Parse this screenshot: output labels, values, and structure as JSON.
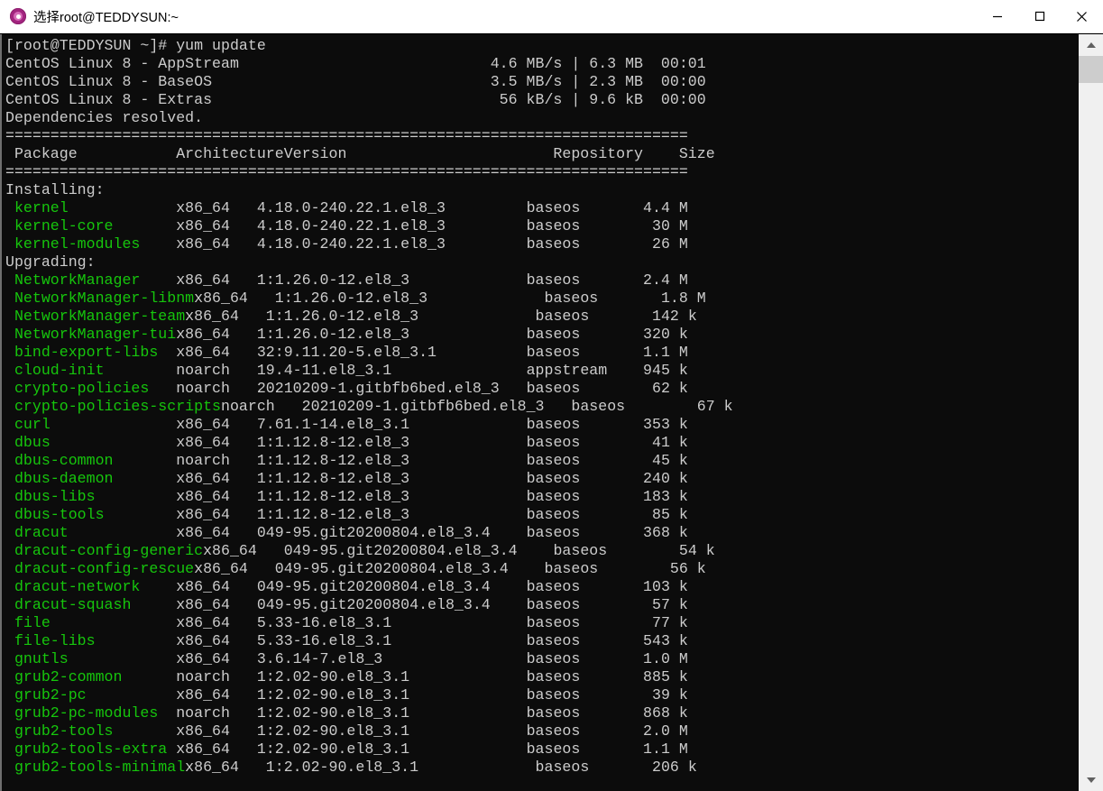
{
  "window": {
    "title": "选择root@TEDDYSUN:~",
    "icon": "terminal-app-icon",
    "controls": {
      "minimize": "minimize-button",
      "maximize": "maximize-button",
      "close": "close-button"
    }
  },
  "terminal": {
    "prompt_line": "[root@TEDDYSUN ~]# yum update",
    "repo_lines": [
      {
        "name": "CentOS Linux 8 - AppStream",
        "speed": "4.6 MB/s",
        "size": "6.3 MB",
        "time": "00:01"
      },
      {
        "name": "CentOS Linux 8 - BaseOS",
        "speed": "3.5 MB/s",
        "size": "2.3 MB",
        "time": "00:00"
      },
      {
        "name": "CentOS Linux 8 - Extras",
        "speed": "56 kB/s",
        "size": "9.6 kB",
        "time": "00:00"
      }
    ],
    "status_line": "Dependencies resolved.",
    "separator": "================================================================================================================================",
    "headers": {
      "package": "Package",
      "architecture": "Architecture",
      "version": "Version",
      "repository": "Repository",
      "size": "Size"
    },
    "sections": [
      {
        "label": "Installing:",
        "rows": [
          {
            "package": "kernel",
            "arch": "x86_64",
            "version": "4.18.0-240.22.1.el8_3",
            "repo": "baseos",
            "size": "4.4 M"
          },
          {
            "package": "kernel-core",
            "arch": "x86_64",
            "version": "4.18.0-240.22.1.el8_3",
            "repo": "baseos",
            "size": "30 M"
          },
          {
            "package": "kernel-modules",
            "arch": "x86_64",
            "version": "4.18.0-240.22.1.el8_3",
            "repo": "baseos",
            "size": "26 M"
          }
        ]
      },
      {
        "label": "Upgrading:",
        "rows": [
          {
            "package": "NetworkManager",
            "arch": "x86_64",
            "version": "1:1.26.0-12.el8_3",
            "repo": "baseos",
            "size": "2.4 M"
          },
          {
            "package": "NetworkManager-libnm",
            "arch": "x86_64",
            "version": "1:1.26.0-12.el8_3",
            "repo": "baseos",
            "size": "1.8 M"
          },
          {
            "package": "NetworkManager-team",
            "arch": "x86_64",
            "version": "1:1.26.0-12.el8_3",
            "repo": "baseos",
            "size": "142 k"
          },
          {
            "package": "NetworkManager-tui",
            "arch": "x86_64",
            "version": "1:1.26.0-12.el8_3",
            "repo": "baseos",
            "size": "320 k"
          },
          {
            "package": "bind-export-libs",
            "arch": "x86_64",
            "version": "32:9.11.20-5.el8_3.1",
            "repo": "baseos",
            "size": "1.1 M"
          },
          {
            "package": "cloud-init",
            "arch": "noarch",
            "version": "19.4-11.el8_3.1",
            "repo": "appstream",
            "size": "945 k"
          },
          {
            "package": "crypto-policies",
            "arch": "noarch",
            "version": "20210209-1.gitbfb6bed.el8_3",
            "repo": "baseos",
            "size": "62 k"
          },
          {
            "package": "crypto-policies-scripts",
            "arch": "noarch",
            "version": "20210209-1.gitbfb6bed.el8_3",
            "repo": "baseos",
            "size": "67 k"
          },
          {
            "package": "curl",
            "arch": "x86_64",
            "version": "7.61.1-14.el8_3.1",
            "repo": "baseos",
            "size": "353 k"
          },
          {
            "package": "dbus",
            "arch": "x86_64",
            "version": "1:1.12.8-12.el8_3",
            "repo": "baseos",
            "size": "41 k"
          },
          {
            "package": "dbus-common",
            "arch": "noarch",
            "version": "1:1.12.8-12.el8_3",
            "repo": "baseos",
            "size": "45 k"
          },
          {
            "package": "dbus-daemon",
            "arch": "x86_64",
            "version": "1:1.12.8-12.el8_3",
            "repo": "baseos",
            "size": "240 k"
          },
          {
            "package": "dbus-libs",
            "arch": "x86_64",
            "version": "1:1.12.8-12.el8_3",
            "repo": "baseos",
            "size": "183 k"
          },
          {
            "package": "dbus-tools",
            "arch": "x86_64",
            "version": "1:1.12.8-12.el8_3",
            "repo": "baseos",
            "size": "85 k"
          },
          {
            "package": "dracut",
            "arch": "x86_64",
            "version": "049-95.git20200804.el8_3.4",
            "repo": "baseos",
            "size": "368 k"
          },
          {
            "package": "dracut-config-generic",
            "arch": "x86_64",
            "version": "049-95.git20200804.el8_3.4",
            "repo": "baseos",
            "size": "54 k"
          },
          {
            "package": "dracut-config-rescue",
            "arch": "x86_64",
            "version": "049-95.git20200804.el8_3.4",
            "repo": "baseos",
            "size": "56 k"
          },
          {
            "package": "dracut-network",
            "arch": "x86_64",
            "version": "049-95.git20200804.el8_3.4",
            "repo": "baseos",
            "size": "103 k"
          },
          {
            "package": "dracut-squash",
            "arch": "x86_64",
            "version": "049-95.git20200804.el8_3.4",
            "repo": "baseos",
            "size": "57 k"
          },
          {
            "package": "file",
            "arch": "x86_64",
            "version": "5.33-16.el8_3.1",
            "repo": "baseos",
            "size": "77 k"
          },
          {
            "package": "file-libs",
            "arch": "x86_64",
            "version": "5.33-16.el8_3.1",
            "repo": "baseos",
            "size": "543 k"
          },
          {
            "package": "gnutls",
            "arch": "x86_64",
            "version": "3.6.14-7.el8_3",
            "repo": "baseos",
            "size": "1.0 M"
          },
          {
            "package": "grub2-common",
            "arch": "noarch",
            "version": "1:2.02-90.el8_3.1",
            "repo": "baseos",
            "size": "885 k"
          },
          {
            "package": "grub2-pc",
            "arch": "x86_64",
            "version": "1:2.02-90.el8_3.1",
            "repo": "baseos",
            "size": "39 k"
          },
          {
            "package": "grub2-pc-modules",
            "arch": "noarch",
            "version": "1:2.02-90.el8_3.1",
            "repo": "baseos",
            "size": "868 k"
          },
          {
            "package": "grub2-tools",
            "arch": "x86_64",
            "version": "1:2.02-90.el8_3.1",
            "repo": "baseos",
            "size": "2.0 M"
          },
          {
            "package": "grub2-tools-extra",
            "arch": "x86_64",
            "version": "1:2.02-90.el8_3.1",
            "repo": "baseos",
            "size": "1.1 M"
          },
          {
            "package": "grub2-tools-minimal",
            "arch": "x86_64",
            "version": "1:2.02-90.el8_3.1",
            "repo": "baseos",
            "size": "206 k"
          }
        ]
      }
    ],
    "colors": {
      "background": "#0c0c0c",
      "foreground": "#cccccc",
      "package_name": "#16c60c"
    },
    "columns": {
      "package": 0,
      "arch": 19,
      "version": 28,
      "repo": 58,
      "size": 70,
      "total_width": 76
    }
  },
  "scrollbar": {
    "up_arrow": "scroll-up-arrow-icon",
    "down_arrow": "scroll-down-arrow-icon"
  }
}
